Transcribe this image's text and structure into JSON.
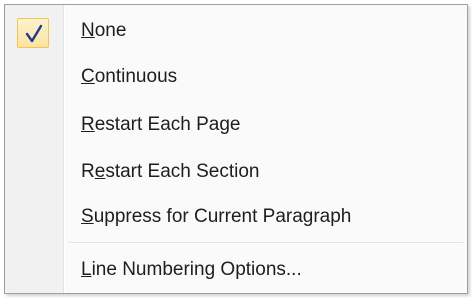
{
  "menu": {
    "items": [
      {
        "accel": "N",
        "rest": "one",
        "checked": true
      },
      {
        "accel": "C",
        "rest": "ontinuous",
        "checked": false
      },
      {
        "accel": "R",
        "rest": "estart Each Page",
        "checked": false
      },
      {
        "prefix": "R",
        "accel": "e",
        "rest": "start Each Section",
        "checked": false
      },
      {
        "accel": "S",
        "rest": "uppress for Current Paragraph",
        "checked": false
      }
    ],
    "options_item": {
      "accel": "L",
      "rest": "ine Numbering Options..."
    }
  },
  "icons": {
    "check": "check-icon"
  },
  "colors": {
    "check_highlight_border": "#f2c458",
    "check_mark": "#1f3a93"
  }
}
